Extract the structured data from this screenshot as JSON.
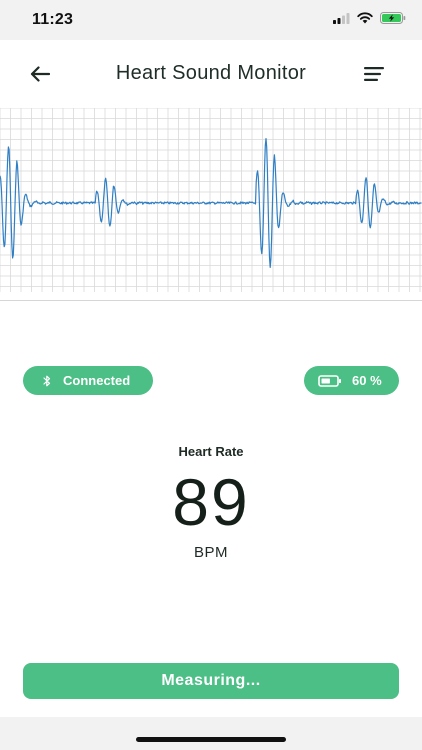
{
  "status_bar": {
    "time": "11:23",
    "icons": [
      "cellular-signal-icon",
      "wifi-icon",
      "battery-charging-icon"
    ]
  },
  "header": {
    "title": "Heart Sound Monitor",
    "back_icon": "arrow-left-icon",
    "menu_icon": "menu-icon"
  },
  "waveform": {
    "line_color": "#2f7fc4",
    "grid_color": "#d9d9d9",
    "beats": [
      {
        "t": 0.015,
        "amp": 1.0
      },
      {
        "t": 0.245,
        "amp": 0.42
      },
      {
        "t": 0.625,
        "amp": 1.15
      },
      {
        "t": 0.862,
        "amp": 0.45
      }
    ]
  },
  "connection": {
    "label": "Connected",
    "icon": "bluetooth-icon"
  },
  "battery": {
    "label": "60 %",
    "level": 0.6,
    "icon": "battery-icon"
  },
  "heart_rate": {
    "label": "Heart Rate",
    "value": "89",
    "unit": "BPM"
  },
  "action": {
    "button_label": "Measuring..."
  },
  "colors": {
    "accent": "#4bbf85",
    "waveform": "#2f7fc4"
  }
}
